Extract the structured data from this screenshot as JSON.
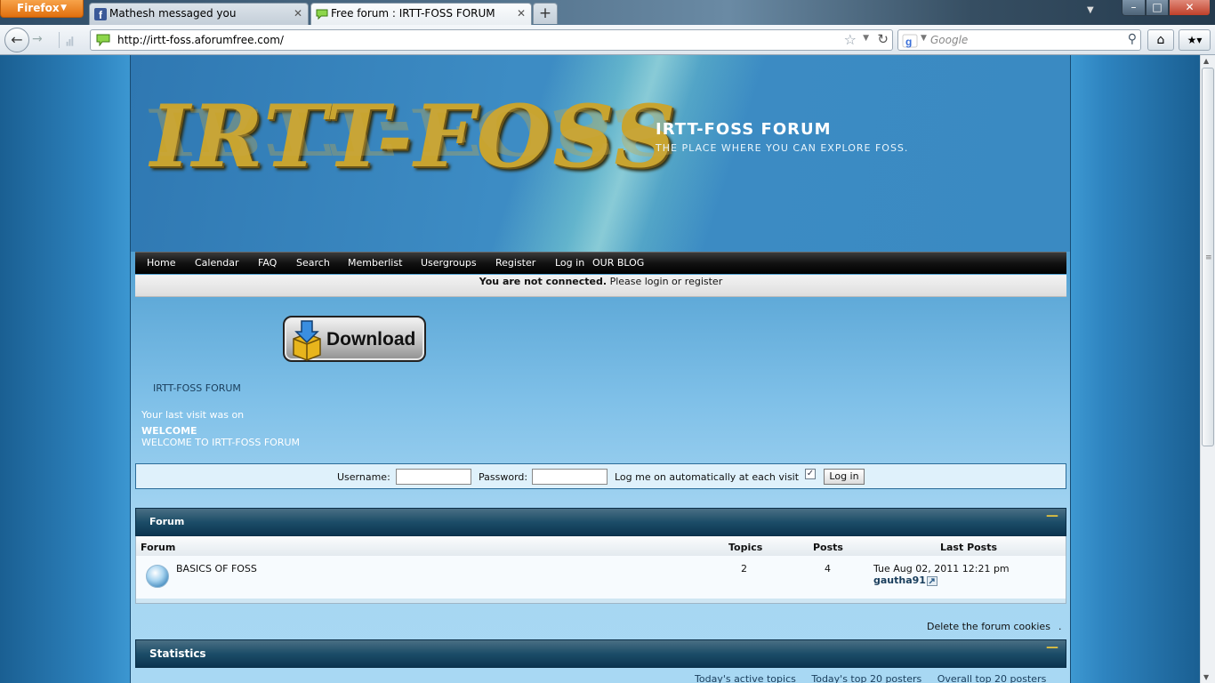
{
  "browser": {
    "app_button": "Firefox",
    "tabs": [
      {
        "title": "Mathesh messaged you",
        "icon": "facebook-icon",
        "active": false
      },
      {
        "title": "Free forum : IRTT-FOSS FORUM",
        "icon": "speech-bubble-icon",
        "active": true
      }
    ],
    "new_tab": "+",
    "url": "http://irtt-foss.aforumfree.com/",
    "search_placeholder": "Google",
    "window_buttons": {
      "minimize": "–",
      "maximize": "□",
      "close": "✕"
    }
  },
  "site": {
    "logo": "IRTT-FOSS",
    "title": "IRTT-FOSS FORUM",
    "description": "THE PLACE WHERE YOU CAN EXPLORE FOSS."
  },
  "menu": {
    "items": [
      "Home",
      "Calendar",
      "FAQ",
      "Search",
      "Memberlist",
      "Usergroups",
      "Register",
      "Log in",
      "OUR BLOG"
    ]
  },
  "connection": {
    "bold": "You are not connected.",
    "rest": "Please login or register"
  },
  "download": {
    "label": "Download"
  },
  "breadcrumb": "IRTT-FOSS FORUM",
  "last_visit": "Your last visit was on",
  "welcome": {
    "title": "WELCOME",
    "text": "WELCOME TO IRTT-FOSS FORUM"
  },
  "login": {
    "username_label": "Username:",
    "password_label": "Password:",
    "auto_label": "Log me on automatically at each visit",
    "auto_checked": true,
    "button": "Log in"
  },
  "forum_section": {
    "title": "Forum",
    "toggle": "—",
    "columns": [
      "Forum",
      "Topics",
      "Posts",
      "Last Posts"
    ],
    "rows": [
      {
        "name": "BASICS OF FOSS",
        "topics": "2",
        "posts": "4",
        "last_date": "Tue Aug 02, 2011 12:21 pm",
        "last_user": "gautha91"
      }
    ]
  },
  "delete_cookies": "Delete the forum cookies",
  "delete_dot": ".",
  "stats_section": {
    "title": "Statistics",
    "toggle": "—",
    "links": [
      "Today's active topics",
      "Today's top 20 posters",
      "Overall top 20 posters"
    ]
  },
  "colors": {
    "accent_orange": "#e16f0e",
    "page_blue": "#3f9ad3",
    "section_head": "#1c4d68",
    "logo_gold": "#c8a430"
  }
}
